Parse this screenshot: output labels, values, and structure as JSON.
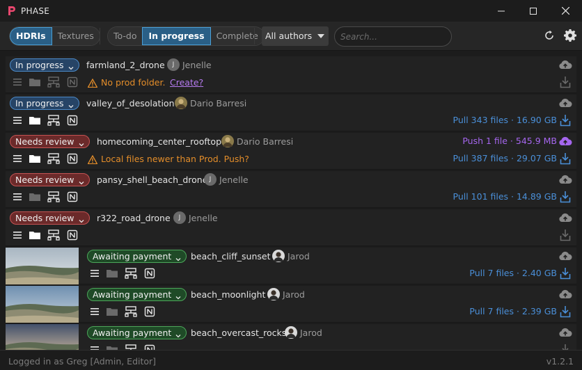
{
  "app": {
    "title": "PHASE"
  },
  "toolbar": {
    "type_tabs": [
      "HDRIs",
      "Textures"
    ],
    "active_type": "HDRIs",
    "status_tabs": [
      "To-do",
      "In progress",
      "Complete"
    ],
    "active_status": "In progress",
    "authors_value": "All authors",
    "search_placeholder": "Search..."
  },
  "rows": [
    {
      "status": "In progress",
      "asset": "farmland_2_drone",
      "author": "Jenelle",
      "avatar": "J",
      "warning": "No prod folder.",
      "warning_link": "Create?",
      "pull": ""
    },
    {
      "status": "In progress",
      "asset": "valley_of_desolation",
      "author": "Dario Barresi",
      "avatar": "",
      "warning": "",
      "pull": "Pull 343 files · 16.90 GB"
    },
    {
      "status": "Needs review",
      "asset": "homecoming_center_rooftop",
      "author": "Dario Barresi",
      "avatar": "",
      "warning": "Local files newer than Prod. Push?",
      "push": "Push 1 file · 545.9 MB",
      "pull": "Pull 387 files · 29.07 GB"
    },
    {
      "status": "Needs review",
      "asset": "pansy_shell_beach_drone",
      "author": "Jenelle",
      "avatar": "J",
      "warning": "",
      "pull": "Pull 101 files · 14.89 GB"
    },
    {
      "status": "Needs review",
      "asset": "r322_road_drone",
      "author": "Jenelle",
      "avatar": "J",
      "warning": "",
      "pull": ""
    },
    {
      "status": "Awaiting payment",
      "asset": "beach_cliff_sunset",
      "author": "Jarod",
      "avatar": "",
      "warning": "",
      "pull": "Pull 7 files · 2.40 GB"
    },
    {
      "status": "Awaiting payment",
      "asset": "beach_moonlight",
      "author": "Jarod",
      "avatar": "",
      "warning": "",
      "pull": "Pull 7 files · 2.39 GB"
    },
    {
      "status": "Awaiting payment",
      "asset": "beach_overcast_rocks",
      "author": "Jarod",
      "avatar": "",
      "warning": "",
      "pull": ""
    }
  ],
  "statusbar": {
    "login": "Logged in as Greg [Admin, Editor]",
    "version": "v1.2.1"
  },
  "colors": {
    "accent_blue": "#4a8fd8",
    "push_purple": "#a566ee",
    "warning_orange": "#e38d2a"
  }
}
